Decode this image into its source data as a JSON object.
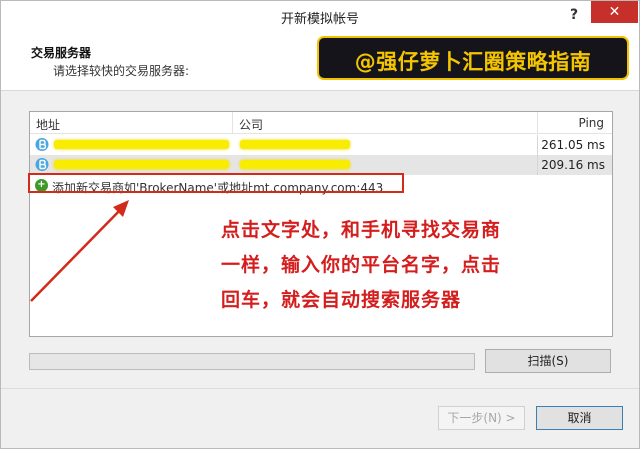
{
  "window": {
    "title": "开新模拟帐号",
    "help_label": "?",
    "close_label": "✕"
  },
  "header": {
    "title": "交易服务器",
    "subtitle": "请选择较快的交易服务器:"
  },
  "banner": {
    "text": "@强仔萝卜汇圈策略指南"
  },
  "table": {
    "columns": [
      "地址",
      "公司",
      "Ping"
    ],
    "rows": [
      {
        "ping": "261.05 ms"
      },
      {
        "ping": "209.16 ms"
      }
    ],
    "add_server_text": "添加新交易商如'BrokerName'或地址mt.company.com:443"
  },
  "annotation": {
    "line1": "点击文字处，和手机寻找交易商",
    "line2": "一样，输入你的平台名字，点击",
    "line3": "回车，就会自动搜索服务器"
  },
  "buttons": {
    "scan": "扫描(S)",
    "next": "下一步(N) >",
    "cancel": "取消"
  },
  "colors": {
    "annotation": "#d41e1e",
    "highlight_box": "#d42a1a",
    "banner_bg": "#14141a",
    "banner_text": "#f4c500",
    "close_button": "#c7302a"
  }
}
